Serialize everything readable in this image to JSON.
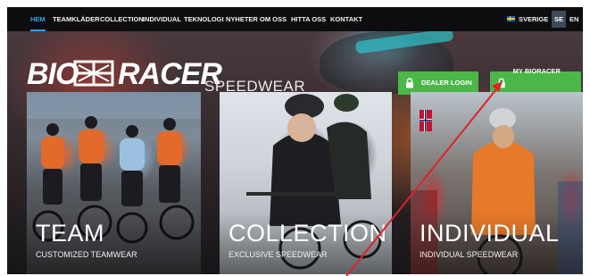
{
  "nav": {
    "items": [
      {
        "label": "HEM",
        "active": true
      },
      {
        "label": "TEAMKLÄDER",
        "active": false
      },
      {
        "label": "COLLECTION",
        "active": false
      },
      {
        "label": "INDIVIDUAL",
        "active": false
      },
      {
        "label": "TEKNOLOGI",
        "active": false
      },
      {
        "label": "NYHETER",
        "active": false
      },
      {
        "label": "OM OSS",
        "active": false
      },
      {
        "label": "HITTA OSS",
        "active": false
      },
      {
        "label": "KONTAKT",
        "active": false
      }
    ],
    "language": {
      "flag_icon": "sweden-flag-icon",
      "current": "SVERIGE",
      "options": [
        "SE",
        "EN"
      ]
    }
  },
  "brand": {
    "logo_left": "BIO",
    "logo_right": "RACER",
    "tagline": "SPEEDWEAR"
  },
  "login": {
    "dealer": "DEALER LOGIN",
    "my": "MY BIORACER LOGIN",
    "icon": "lock-icon"
  },
  "tiles": [
    {
      "title": "TEAM",
      "subtitle": "CUSTOMIZED TEAMWEAR"
    },
    {
      "title": "COLLECTION",
      "subtitle": "EXCLUSIVE SPEEDWEAR"
    },
    {
      "title": "INDIVIDUAL",
      "subtitle": "INDIVIDUAL SPEEDWEAR"
    }
  ],
  "colors": {
    "accent": "#2aa6e8",
    "login_green": "#4bb748",
    "annotation_arrow": "#e0202a"
  }
}
